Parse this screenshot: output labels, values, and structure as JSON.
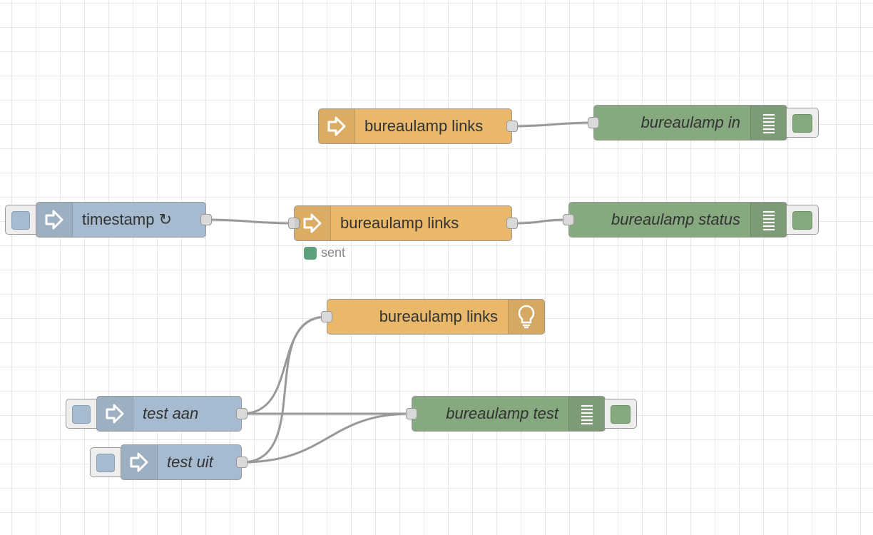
{
  "nodes": {
    "mqtt_in_top": {
      "label": "bureaulamp links",
      "icon": "bridge-icon"
    },
    "debug_in": {
      "label": "bureaulamp in",
      "icon": "list-icon"
    },
    "inject_timestamp": {
      "label": "timestamp ↻",
      "icon": "arrow-icon"
    },
    "mqtt_middle": {
      "label": "bureaulamp links",
      "icon": "bridge-icon",
      "status": "sent",
      "status_color": "#5ba17c"
    },
    "debug_status": {
      "label": "bureaulamp status",
      "icon": "list-icon"
    },
    "mqtt_light": {
      "label": "bureaulamp links",
      "icon": "lightbulb-icon"
    },
    "inject_aan": {
      "label": "test aan",
      "icon": "arrow-icon"
    },
    "debug_test": {
      "label": "bureaulamp test",
      "icon": "list-icon"
    },
    "inject_uit": {
      "label": "test uit",
      "icon": "arrow-icon"
    }
  },
  "colors": {
    "inject": "#a6bbcf",
    "mqtt": "#e9b86b",
    "debug": "#87a980",
    "wire": "#999999",
    "status_ok": "#5ba17c"
  }
}
